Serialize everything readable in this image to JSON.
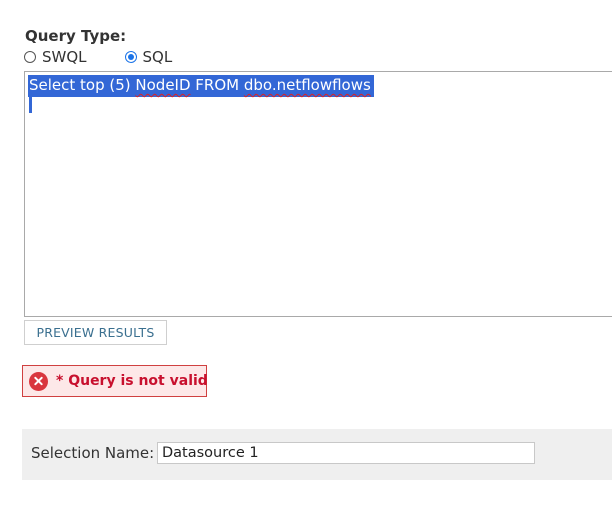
{
  "query_type": {
    "label": "Query Type:",
    "options": [
      {
        "label": "SWQL",
        "selected": false
      },
      {
        "label": "SQL",
        "selected": true
      }
    ]
  },
  "query": {
    "text_parts": [
      "Select top (5) ",
      "NodeID",
      " FROM ",
      "dbo.netflowflows"
    ],
    "selected": true
  },
  "preview_button": {
    "label": "PREVIEW RESULTS"
  },
  "error": {
    "icon": "error-x-circle-icon",
    "message": "* Query is not valid"
  },
  "selection": {
    "label": "Selection Name:",
    "value": "Datasource 1"
  },
  "colors": {
    "selection_highlight": "#3367d6",
    "radio_accent": "#1a73e8",
    "error_text": "#c8102e",
    "error_bg": "#fde8e8",
    "button_text": "#3a6f8f"
  }
}
